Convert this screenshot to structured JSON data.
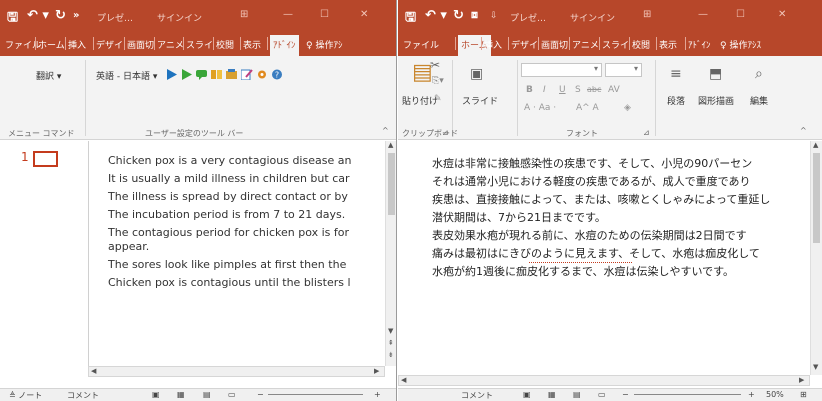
{
  "left": {
    "title": "プレゼ…",
    "signin": "サインイン",
    "tabs": [
      "ファイル",
      "ホーム",
      "挿入",
      "デザイ",
      "画面切",
      "アニメ",
      "スライ",
      "校閲",
      "表示",
      "ｱﾄﾞｲﾝ",
      "♀ 操作ｱｼ"
    ],
    "active_tab": "ｱﾄﾞｲﾝ",
    "ribbon": {
      "translate": "翻訳 ▾",
      "lang": "英語 - 日本語 ▾",
      "group_menu": "メニュー コマンド",
      "group_toolbar": "ユーザー設定のツール バー"
    },
    "slide_number": "1",
    "outline": [
      "Chicken pox is a very contagious disease an",
      "It is usually a mild illness in children but car",
      "The illness is spread by direct contact or by",
      "The incubation period is from 7 to 21 days.",
      "The contagious period for chicken pox is for",
      "appear.",
      "The sores look like pimples at first then the",
      "Chicken pox is contagious until the blisters l"
    ],
    "status": {
      "notes": "≜ ノート",
      "comments": "コメント"
    }
  },
  "right": {
    "title": "プレゼ…",
    "signin": "サインイン",
    "tabs": [
      "ファイル",
      "ホーム",
      "挿入",
      "デザイ",
      "画面切",
      "アニメ",
      "スライ",
      "校閲",
      "表示",
      "ｱﾄﾞｲﾝ",
      "♀ 操作ｱｼｽ"
    ],
    "active_tab": "ホーム",
    "ribbon": {
      "paste": "貼り付け",
      "slide": "スライド",
      "font_group": "フォント",
      "clipboard_group": "クリップボード",
      "paragraph": "段落",
      "drawing": "図形描画",
      "editing": "編集",
      "bold": "B",
      "italic": "I",
      "underline": "U",
      "strike": "S",
      "abc": "abc",
      "av": "AV",
      "aa": "A ⋅ Aa ⋅",
      "ab": "A^ A"
    },
    "text": [
      "水痘は非常に接触感染性の疾患です、そして、小児の90パーセン",
      "それは通常小児における軽度の疾患であるが、成人で重度であり",
      "疾患は、直接接触によって、または、咳嗽とくしゃみによって重延し",
      "潜伏期間は、7から21日までです。",
      "表皮効果水疱が現れる前に、水痘のための伝染期間は2日間です",
      "痛みは最初はにきびのように見えます、そして、水疱は痂皮化して",
      "水疱が約1週後に痂皮化するまで、水痘は伝染しやすいです。"
    ],
    "status": {
      "comments": "コメント",
      "zoom": "50%"
    }
  },
  "colors": {
    "accent": "#b7472a",
    "slide_num": "#c43b1d"
  }
}
